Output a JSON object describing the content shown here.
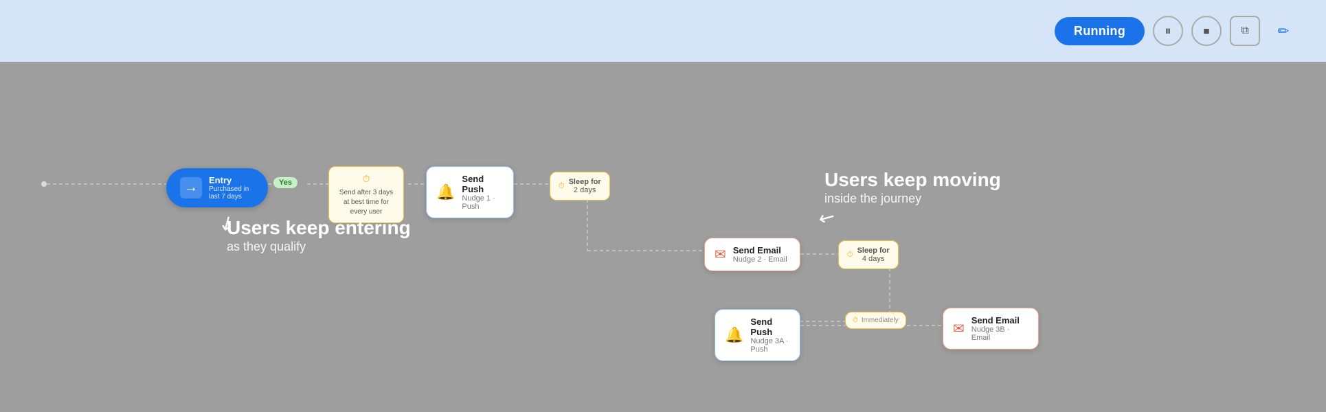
{
  "header": {
    "running_label": "Running",
    "pause_icon": "⏸",
    "stop_icon": "⏹",
    "copy_icon": "⧉",
    "edit_icon": "✏"
  },
  "canvas": {
    "nodes": {
      "entry": {
        "title": "Entry",
        "subtitle": "Purchased in last 7 days",
        "icon": "→"
      },
      "condition": {
        "icon": "⏱",
        "line1": "Send after 3 days",
        "line2": "at best time for",
        "line3": "every user"
      },
      "yes_badge": "Yes",
      "send_push_1": {
        "title": "Send Push",
        "subtitle": "Nudge 1 · Push"
      },
      "sleep_1": {
        "icon": "⏱",
        "line1": "Sleep for",
        "line2": "2 days"
      },
      "send_email_2": {
        "title": "Send Email",
        "subtitle": "Nudge 2 · Email"
      },
      "sleep_2": {
        "icon": "⏱",
        "line1": "Sleep for",
        "line2": "4 days"
      },
      "send_push_3a": {
        "title": "Send Push",
        "subtitle": "Nudge 3A · Push"
      },
      "immediately": {
        "icon": "⏱",
        "label": "Immediately"
      },
      "send_email_3b": {
        "title": "Send Email",
        "subtitle": "Nudge 3B · Email"
      }
    },
    "annotations": {
      "entering": {
        "heading": "Users keep entering",
        "subtext": "as they qualify"
      },
      "moving": {
        "heading": "Users keep moving",
        "subtext": "inside the journey"
      }
    }
  }
}
